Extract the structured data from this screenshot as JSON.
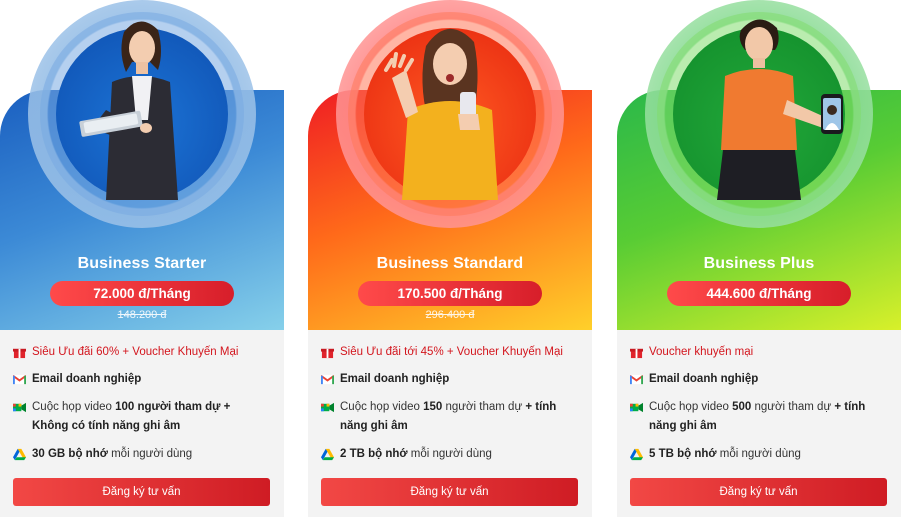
{
  "plans": [
    {
      "name": "Business Starter",
      "price": "72.000 đ/Tháng",
      "old_price": "148.200 đ",
      "promo": "Siêu Ưu đãi 60% + Voucher Khuyến Mại",
      "email": "Email doanh nghiệp",
      "video": {
        "pre": "Cuộc họp video ",
        "bold1": "100 người tham dự +",
        "mid": "",
        "bold2": "Không có tính năng ghi âm",
        "post": ""
      },
      "storage": {
        "bold": "30 GB bộ nhớ",
        "rest": " mỗi người dùng"
      },
      "cta": "Đăng ký tư vấn",
      "colors": {
        "accent": "#1a5fc0"
      }
    },
    {
      "name": "Business Standard",
      "price": "170.500 đ/Tháng",
      "old_price": "296.400 đ",
      "promo": "Siêu Ưu đãi tới 45% + Voucher Khuyến Mại",
      "email": "Email doanh nghiệp",
      "video": {
        "pre": "Cuộc họp video ",
        "bold1": "150",
        "mid": " người tham dự ",
        "bold2": "+ tính năng ghi âm",
        "post": ""
      },
      "storage": {
        "bold": "2 TB bộ nhớ",
        "rest": " mỗi người dùng"
      },
      "cta": "Đăng ký tư vấn",
      "colors": {
        "accent": "#ef1d24"
      }
    },
    {
      "name": "Business Plus",
      "price": "444.600 đ/Tháng",
      "old_price": "",
      "promo": "Voucher khuyến mại",
      "email": "Email doanh nghiệp",
      "video": {
        "pre": "Cuộc họp video ",
        "bold1": "500",
        "mid": " người tham dự ",
        "bold2": "+ tính năng ghi âm",
        "post": ""
      },
      "storage": {
        "bold": "5 TB bộ nhớ",
        "rest": " mỗi người dùng"
      },
      "cta": "Đăng ký tư vấn",
      "colors": {
        "accent": "#2ab84a"
      }
    }
  ],
  "icons": {
    "promo": "gift-icon",
    "email": "gmail-icon",
    "video": "google-meet-icon",
    "storage": "google-drive-icon"
  },
  "theme": {
    "price_pill": "#e7272f",
    "cta": "#e02d30",
    "promo_text": "#d3161e"
  }
}
